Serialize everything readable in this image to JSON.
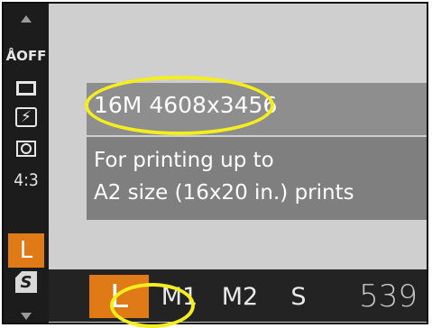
{
  "side_menu": {
    "items": [
      {
        "label": "ÅOFF",
        "icon": "auto-off-icon"
      },
      {
        "label": "□",
        "icon": "rectangle-icon"
      },
      {
        "label": "⚡∕",
        "icon": "flash-off-icon"
      },
      {
        "label": "◎",
        "icon": "metering-icon"
      },
      {
        "label": "4:3",
        "icon": "aspect-ratio"
      },
      {
        "label": "L",
        "icon": "image-size",
        "selected": true
      },
      {
        "label": "S",
        "icon": "quality-icon"
      }
    ]
  },
  "info": {
    "resolution": "16M 4608x3456",
    "description_line1": "For printing up to",
    "description_line2": "A2 size (16x20 in.) prints"
  },
  "size_options": {
    "options": [
      "L",
      "M1",
      "M2",
      "S"
    ],
    "selected_index": 0
  },
  "shots_remaining": "539",
  "colors": {
    "accent": "#e07a17",
    "highlight": "#f4ee1e",
    "panel": "#8e8e8e"
  }
}
